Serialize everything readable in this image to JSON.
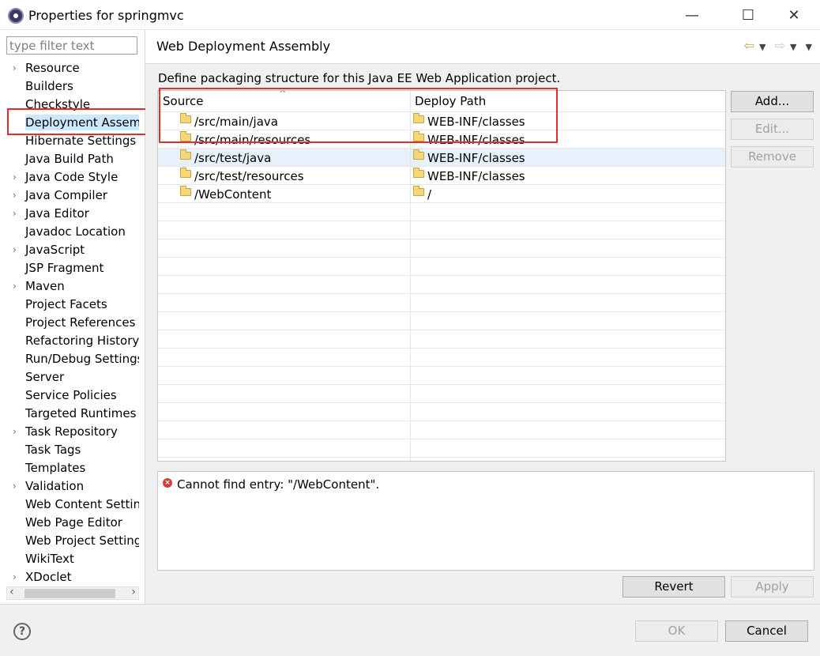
{
  "window": {
    "title": "Properties for springmvc",
    "minimize": "—",
    "maximize": "☐",
    "close": "✕"
  },
  "filter": {
    "placeholder": "type filter text"
  },
  "tree_items": [
    {
      "label": "Resource",
      "expandable": true
    },
    {
      "label": "Builders",
      "expandable": false
    },
    {
      "label": "Checkstyle",
      "expandable": false
    },
    {
      "label": "Deployment Assem",
      "expandable": false,
      "selected": true
    },
    {
      "label": "Hibernate Settings",
      "expandable": false
    },
    {
      "label": "Java Build Path",
      "expandable": false
    },
    {
      "label": "Java Code Style",
      "expandable": true
    },
    {
      "label": "Java Compiler",
      "expandable": true
    },
    {
      "label": "Java Editor",
      "expandable": true
    },
    {
      "label": "Javadoc Location",
      "expandable": false
    },
    {
      "label": "JavaScript",
      "expandable": true
    },
    {
      "label": "JSP Fragment",
      "expandable": false
    },
    {
      "label": "Maven",
      "expandable": true
    },
    {
      "label": "Project Facets",
      "expandable": false
    },
    {
      "label": "Project References",
      "expandable": false
    },
    {
      "label": "Refactoring History",
      "expandable": false
    },
    {
      "label": "Run/Debug Settings",
      "expandable": false
    },
    {
      "label": "Server",
      "expandable": false
    },
    {
      "label": "Service Policies",
      "expandable": false
    },
    {
      "label": "Targeted Runtimes",
      "expandable": false
    },
    {
      "label": "Task Repository",
      "expandable": true
    },
    {
      "label": "Task Tags",
      "expandable": false
    },
    {
      "label": "Templates",
      "expandable": false
    },
    {
      "label": "Validation",
      "expandable": true
    },
    {
      "label": "Web Content Settin",
      "expandable": false
    },
    {
      "label": "Web Page Editor",
      "expandable": false
    },
    {
      "label": "Web Project Setting",
      "expandable": false
    },
    {
      "label": "WikiText",
      "expandable": false
    },
    {
      "label": "XDoclet",
      "expandable": true
    }
  ],
  "page": {
    "title": "Web Deployment Assembly",
    "description": "Define packaging structure for this Java EE Web Application project."
  },
  "table": {
    "columns": [
      "Source",
      "Deploy Path"
    ],
    "rows": [
      {
        "source": "/src/main/java",
        "deploy": "WEB-INF/classes"
      },
      {
        "source": "/src/main/resources",
        "deploy": "WEB-INF/classes"
      },
      {
        "source": "/src/test/java",
        "deploy": "WEB-INF/classes",
        "highlighted": true
      },
      {
        "source": "/src/test/resources",
        "deploy": "WEB-INF/classes"
      },
      {
        "source": "/WebContent",
        "deploy": "/"
      }
    ],
    "empty_rows": 14
  },
  "buttons": {
    "add": "Add...",
    "edit": "Edit...",
    "remove": "Remove",
    "revert": "Revert",
    "apply": "Apply",
    "ok": "OK",
    "cancel": "Cancel"
  },
  "messages": {
    "error": "Cannot find entry: \"/WebContent\"."
  },
  "colors": {
    "annotation_red": "#e52d2d",
    "selection_blue": "#cce8ff",
    "folder_yellow": "#f6d777"
  }
}
